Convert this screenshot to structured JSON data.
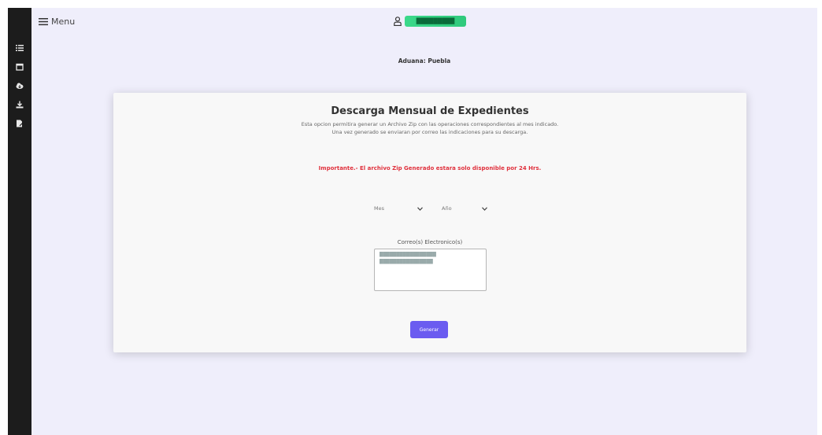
{
  "header": {
    "menu_label": "Menu",
    "user_badge": "█████████"
  },
  "sidebar": {
    "items": [
      {
        "icon": "list-icon"
      },
      {
        "icon": "calendar-icon"
      },
      {
        "icon": "cloud-download-icon"
      },
      {
        "icon": "download-icon"
      },
      {
        "icon": "file-edit-icon"
      }
    ]
  },
  "page": {
    "aduana": "Aduana: Puebla",
    "title": "Descarga Mensual de Expedientes",
    "description_1": "Esta opcion permitira generar un Archivo Zip con las operaciones correspondientes al mes indicado.",
    "description_2": "Una vez generado se enviaran por correo las indicaciones para su descarga.",
    "important": "Importante.- El archivo Zip Generado estara solo disponible por 24 Hrs.",
    "select_mes": "Mes",
    "select_anio": "Año",
    "email_label": "Correo(s) Electronico(s)",
    "emails": [
      "█████████████████",
      "████████████████"
    ],
    "generate_label": "Generar"
  },
  "colors": {
    "sidebar": "#1c1c1c",
    "background": "#efeefb",
    "accent": "#6b5cf0",
    "important": "#e0303c",
    "user_badge": "#3bd98a"
  }
}
